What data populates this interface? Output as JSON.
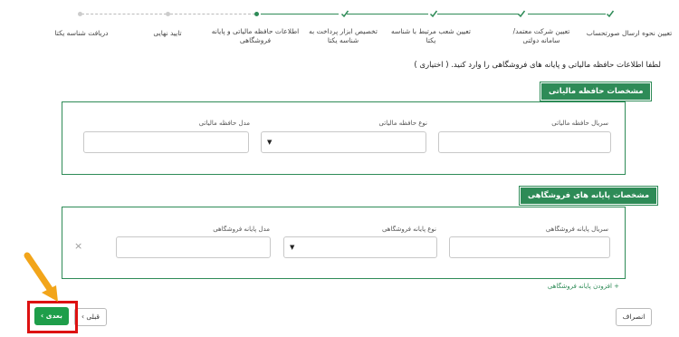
{
  "steps": [
    {
      "label": "تعیین نحوه ارسال صورتحساب",
      "status": "done"
    },
    {
      "label": "تعیین شرکت معتمد/سامانه دولتی",
      "status": "done"
    },
    {
      "label": "تعیین شعب مرتبط با شناسه یکتا",
      "status": "done"
    },
    {
      "label": "تخصیص ابزار پرداخت به شناسه یکتا",
      "status": "done"
    },
    {
      "label": "اطلاعات حافظه مالیاتی و پایانه فروشگاهی",
      "status": "active"
    },
    {
      "label": "تایید نهایی",
      "status": "pending"
    },
    {
      "label": "دریافت شناسه یکتا",
      "status": "pending"
    }
  ],
  "instruction": "لطفا اطلاعات حافظه مالیاتی و پایانه های فروشگاهی را وارد کنید. ( اختیاری )",
  "fiscal_memory": {
    "title": "مشخصات حافظه مالیاتی",
    "serial_label": "سریال حافظه مالیاتی",
    "type_label": "نوع حافظه مالیاتی",
    "model_label": "مدل حافظه مالیاتی",
    "type_caret": "▼"
  },
  "terminals": {
    "title": "مشخصات پایانه های فروشگاهی",
    "serial_label": "سریال پایانه فروشگاهی",
    "type_label": "نوع پایانه فروشگاهی",
    "model_label": "مدل پایانه فروشگاهی",
    "type_caret": "▼",
    "remove_icon": "×",
    "add_label": "+ افزودن پایانه فروشگاهی"
  },
  "buttons": {
    "cancel": "انصراف",
    "prev": "قبلی ›",
    "next": "بعدی ›"
  },
  "colors": {
    "accent": "#2e8b57",
    "highlight": "#d11111",
    "arrow": "#f2a51a"
  }
}
